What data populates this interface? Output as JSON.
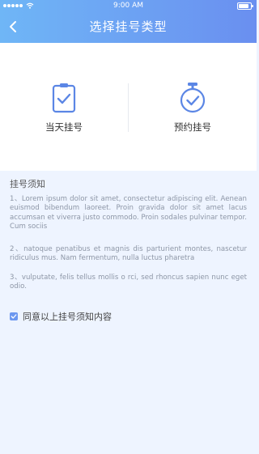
{
  "status_bar": {
    "time": "9:00 AM"
  },
  "header": {
    "title": "选择挂号类型",
    "back_icon": "chevron-left-icon"
  },
  "types": [
    {
      "label": "当天挂号",
      "icon": "clipboard-check-icon"
    },
    {
      "label": "预约挂号",
      "icon": "stopwatch-check-icon"
    }
  ],
  "notice": {
    "title": "挂号须知",
    "paragraphs": [
      "1、Lorem ipsum dolor sit amet, consectetur adipiscing elit. Aenean euismod bibendum laoreet. Proin gravida dolor sit amet lacus accumsan et viverra justo commodo. Proin sodales pulvinar tempor. Cum sociis",
      "2、natoque penatibus et magnis dis parturient montes, nascetur ridiculus mus. Nam fermentum, nulla luctus pharetra",
      "3、vulputate, felis tellus mollis o rci, sed rhoncus sapien nunc eget odio."
    ],
    "agree_label": "同意以上挂号须知内容",
    "agree_checked": true
  },
  "colors": {
    "header_gradient_start": "#6fb6f6",
    "header_gradient_end": "#6a8ff0",
    "icon_accent": "#5b86e5",
    "page_background": "#eef4ff"
  }
}
